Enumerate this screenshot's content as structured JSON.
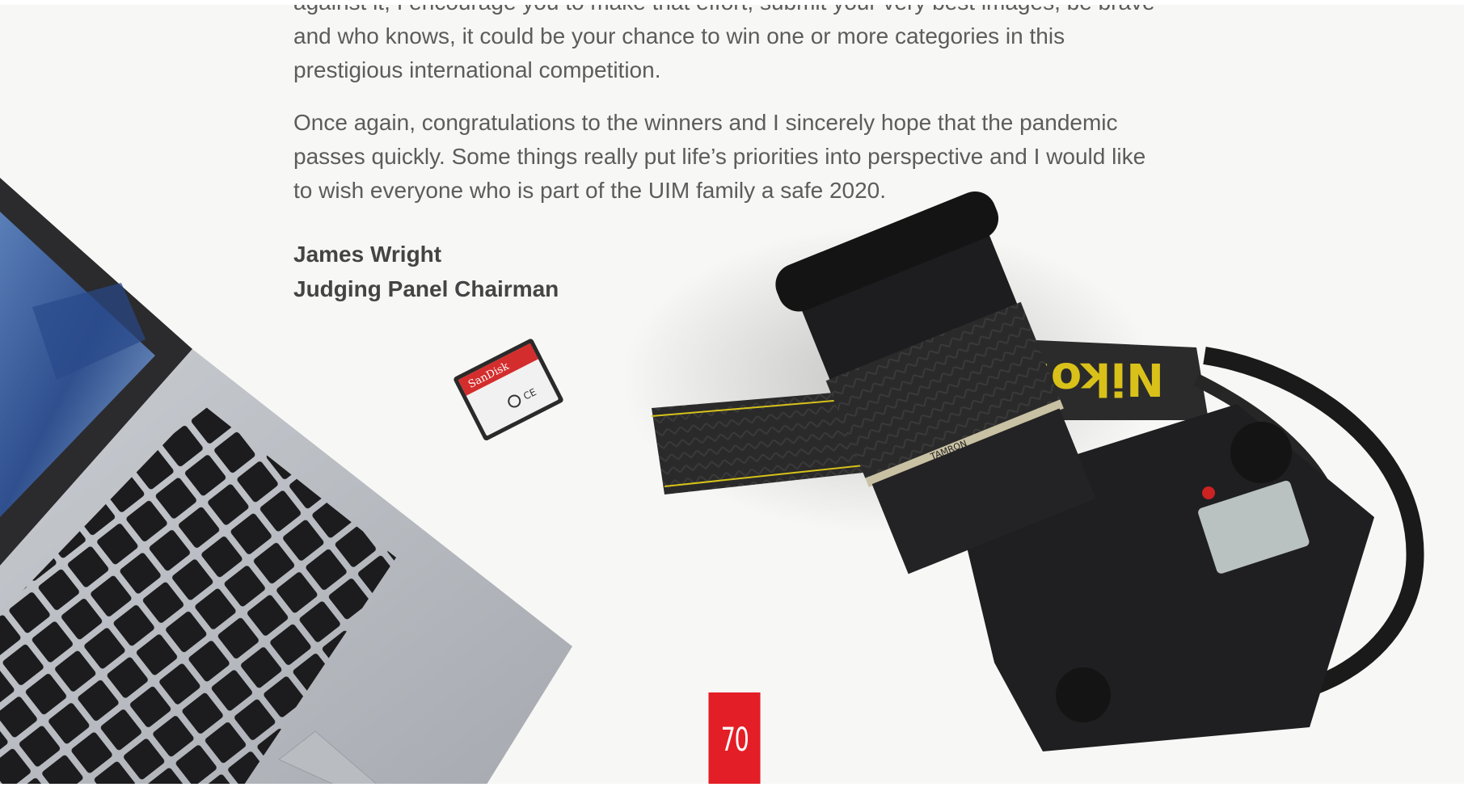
{
  "body_text": {
    "paragraph_1": "against it, I encourage you to make that effort, submit your very best images, be brave and who knows, it could be your chance to win one or more categories in this prestigious international competition.",
    "paragraph_2": "Once again, congratulations to the winners and I sincerely hope that the pandemic passes quickly. Some things really put life’s priorities into perspective and I would like to wish everyone who is part of the UIM family a safe 2020."
  },
  "signature": {
    "name": "James Wright",
    "title": "Judging Panel Chairman"
  },
  "photo": {
    "sd_card_brand": "SanDisk",
    "strap_brand": "Nikon",
    "lens_brand": "TAMRON"
  },
  "page_number": "70",
  "colors": {
    "accent": "#e41e26",
    "body_text": "#5c5c5c",
    "background": "#f7f7f5"
  }
}
